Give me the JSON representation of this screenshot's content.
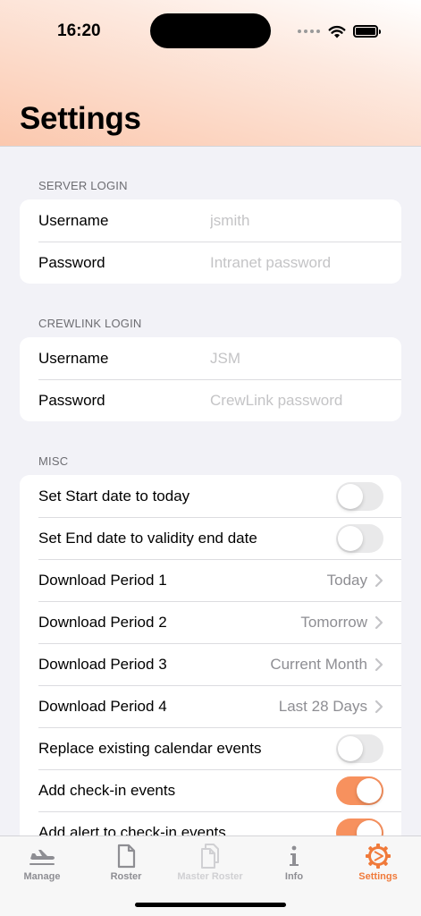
{
  "status_bar": {
    "time": "16:20"
  },
  "page": {
    "title": "Settings"
  },
  "sections": {
    "server_login": {
      "header": "SERVER LOGIN",
      "username_label": "Username",
      "username_placeholder": "jsmith",
      "password_label": "Password",
      "password_placeholder": "Intranet password"
    },
    "crewlink_login": {
      "header": "CREWLINK LOGIN",
      "username_label": "Username",
      "username_placeholder": "JSM",
      "password_label": "Password",
      "password_placeholder": "CrewLink password"
    },
    "misc": {
      "header": "MISC",
      "rows": [
        {
          "label": "Set Start date to today",
          "toggle_on": false
        },
        {
          "label": "Set End date to validity end date",
          "toggle_on": false
        },
        {
          "label": "Download Period 1",
          "value": "Today"
        },
        {
          "label": "Download Period 2",
          "value": "Tomorrow"
        },
        {
          "label": "Download Period 3",
          "value": "Current Month"
        },
        {
          "label": "Download Period 4",
          "value": "Last 28 Days"
        },
        {
          "label": "Replace existing calendar events",
          "toggle_on": false
        },
        {
          "label": "Add check-in events",
          "toggle_on": true
        },
        {
          "label": "Add alert to check-in events",
          "toggle_on": true
        }
      ]
    }
  },
  "tab_bar": {
    "tabs": [
      {
        "label": "Manage",
        "icon": "airplane-icon",
        "state": "normal"
      },
      {
        "label": "Roster",
        "icon": "document-icon",
        "state": "normal"
      },
      {
        "label": "Master Roster",
        "icon": "documents-icon",
        "state": "disabled"
      },
      {
        "label": "Info",
        "icon": "info-icon",
        "state": "normal"
      },
      {
        "label": "Settings",
        "icon": "gear-icon",
        "state": "active"
      }
    ]
  },
  "colors": {
    "accent": "#f7915e",
    "active_tab": "#f07a3a",
    "header_gradient_end": "#fbc8ae",
    "background": "#f2f2f7"
  }
}
